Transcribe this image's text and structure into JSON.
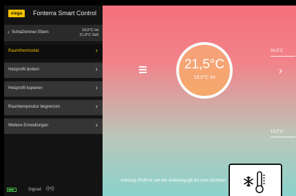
{
  "app": {
    "logo_text": "viega",
    "title": "Fonterra Smart Control",
    "brand_color": "#f2c200"
  },
  "room": {
    "name": "Schlafzimmer Eltern",
    "actual_temp": "19,0°C Ist",
    "target_temp": "21,0°C Soll"
  },
  "menu": [
    {
      "label": "Raumthermostat",
      "active": true
    },
    {
      "label": "Heizprofil ändern",
      "active": false
    },
    {
      "label": "Heizprofil kopieren",
      "active": false
    },
    {
      "label": "Raumtemperatur begrenzen",
      "active": false
    },
    {
      "label": "Weitere Einstellungen",
      "active": false
    }
  ],
  "status": {
    "signal_label": "Signal:",
    "signal_icon": "wifi-signal-icon",
    "battery_level": 0.75,
    "battery_color": "#47c447"
  },
  "dial": {
    "set_temp": "21,5°C",
    "actual_temp": "19,0°C Ist"
  },
  "scale": {
    "max": "24,5°C",
    "min": "13,5°C"
  },
  "warning": "Achtung: Profil ist seit der Änderung gilt bis zum nächsten",
  "mode_icon": "snowflake-thermometer-icon",
  "icons": {
    "back": "chevron-left-icon",
    "menu_arrow": "chevron-right-icon",
    "hamburger": "hamburger-icon",
    "next": "chevron-right-icon"
  }
}
